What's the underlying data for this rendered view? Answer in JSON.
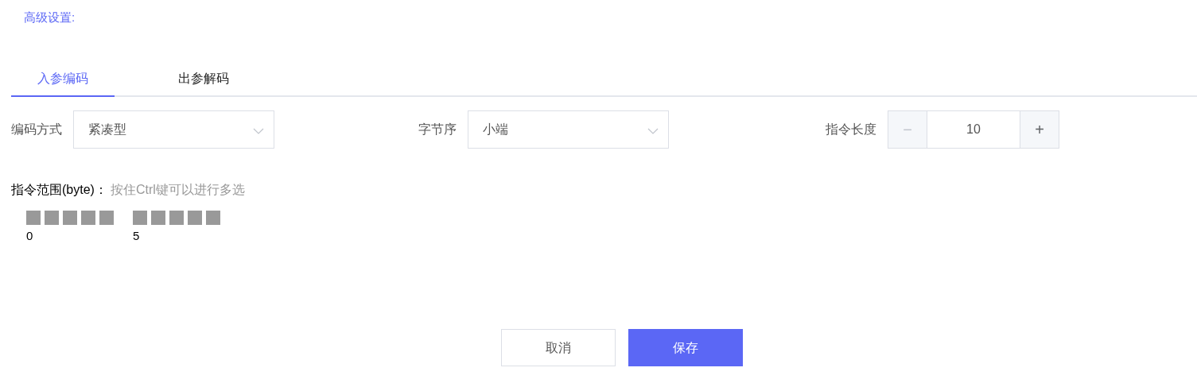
{
  "advanced_link": "高级设置:",
  "tabs": [
    {
      "label": "入参编码",
      "selected": true
    },
    {
      "label": "出参解码",
      "selected": false
    }
  ],
  "fields": [
    {
      "kind": "select",
      "label": "编码方式",
      "value": "紧凑型"
    },
    {
      "kind": "select",
      "label": "字节序",
      "value": "小端"
    },
    {
      "kind": "stepper",
      "label": "指令长度",
      "value": "10",
      "minus": "−",
      "plus": "+",
      "minus_disabled": true
    }
  ],
  "range": {
    "label": "指令范围(byte)：",
    "hint": "按住Ctrl键可以进行多选",
    "groups": [
      {
        "start": "0"
      },
      {
        "start": "5"
      }
    ]
  },
  "buttons": [
    {
      "kind": "secondary",
      "label": "取消"
    },
    {
      "kind": "primary",
      "label": "保存"
    }
  ]
}
